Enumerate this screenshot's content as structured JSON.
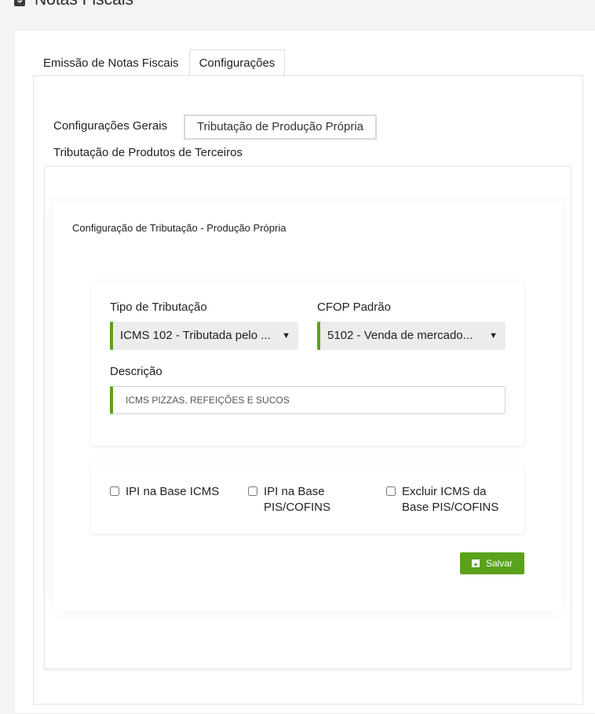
{
  "page": {
    "title": "Notas Fiscais",
    "title_icon": "dollar-document-icon",
    "icon_glyph": "$"
  },
  "main_tabs": [
    {
      "label": "Emissão de Notas Fiscais",
      "active": false
    },
    {
      "label": "Configurações",
      "active": true
    }
  ],
  "sub_tabs": [
    {
      "label": "Configurações Gerais",
      "active": false
    },
    {
      "label": "Tributação de Produção Própria",
      "active": true
    },
    {
      "label": "Tributação de Produtos de Terceiros",
      "active": false
    }
  ],
  "config": {
    "title": "Configuração de Tributação - Produção Própria",
    "tipo_label": "Tipo de Tributação",
    "tipo_value": "ICMS 102 - Tributada pelo ...",
    "cfop_label": "CFOP Padrão",
    "cfop_value": "5102 - Venda de mercado...",
    "descricao_label": "Descrição",
    "descricao_value": "ICMS PIZZAS, REFEIÇÕES E SUCOS",
    "checkboxes": [
      {
        "label": "IPI na Base ICMS",
        "checked": false
      },
      {
        "label": "IPI na Base PIS/COFINS",
        "checked": false
      },
      {
        "label": "Excluir ICMS da Base PIS/COFINS",
        "checked": false
      }
    ],
    "save_label": "Salvar"
  },
  "colors": {
    "accent": "#5aa21b",
    "background": "#f4f4f4"
  }
}
